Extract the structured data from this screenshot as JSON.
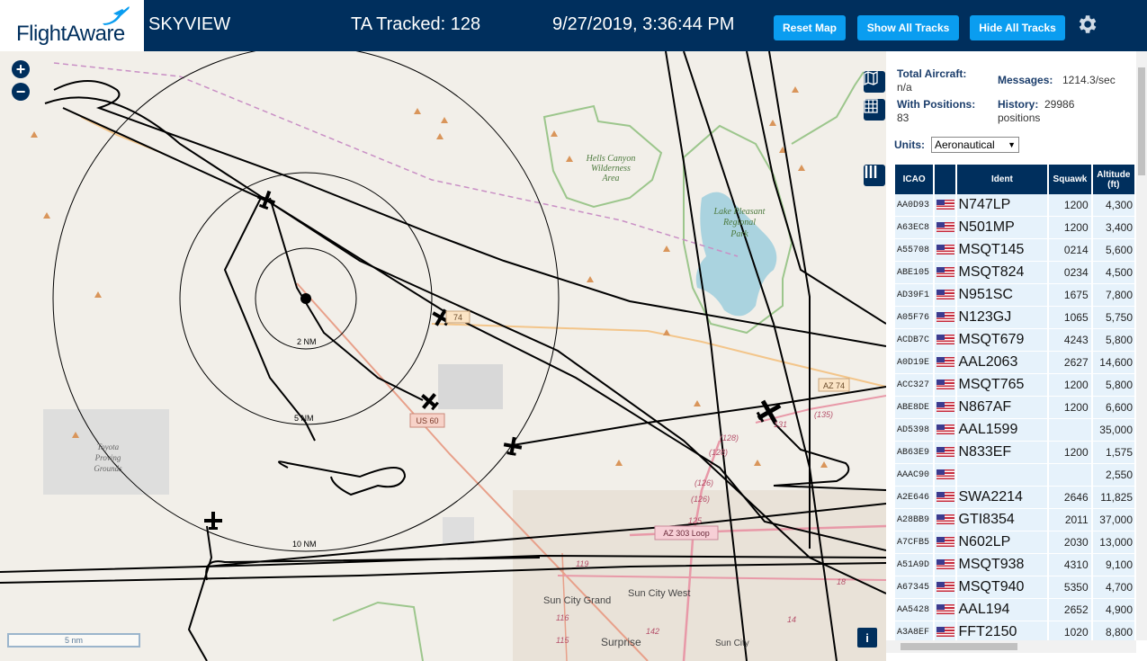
{
  "header": {
    "logo_text": "FlightAware",
    "app_title": "SKYVIEW",
    "ta_tracked": "TA Tracked: 128",
    "clock": "9/27/2019, 3:36:44 PM",
    "reset_map": "Reset Map",
    "show_all_tracks": "Show All Tracks",
    "hide_all_tracks": "Hide All Tracks",
    "settings_icon": "gear-icon",
    "bg_color": "#002f5d",
    "button_color": "#0a9df0"
  },
  "map": {
    "zoom_in": "+",
    "zoom_out": "−",
    "scale_label": "5 nm",
    "info_label": "i",
    "range_rings": [
      "2 NM",
      "5 NM",
      "10 NM"
    ],
    "labels": {
      "hells_canyon": [
        "Hells Canyon",
        "Wilderness",
        "Area"
      ],
      "lake_pleasant": [
        "Lake Pleasant",
        "Regional",
        "Park"
      ],
      "toyota": [
        "Toyota",
        "Proving",
        "Grounds"
      ],
      "sun_city_grand": "Sun City Grand",
      "sun_city_west": "Sun City West",
      "surprise": "Surprise",
      "sun_city": "Sun City",
      "us60": "US 60",
      "az74": "AZ 74",
      "az303": "AZ 303 Loop",
      "r74": "74",
      "r131": "131",
      "r135": "(135)",
      "r128": "(128)",
      "r126": "(126)",
      "r125": "125",
      "r119": "119",
      "r116": "116",
      "r115": "115",
      "r142": "142",
      "r14": "14",
      "r18": "18"
    }
  },
  "stats": {
    "total_aircraft_label": "Total Aircraft:",
    "total_aircraft_value": "n/a",
    "with_positions_label": "With Positions:",
    "with_positions_value": "83",
    "messages_label": "Messages:",
    "messages_value": "1214.3/sec",
    "history_label": "History:",
    "history_value": "29986",
    "history_unit": "positions",
    "units_label": "Units:",
    "units_value": "Aeronautical"
  },
  "table": {
    "headers": {
      "icao": "ICAO",
      "ident": "Ident",
      "squawk": "Squawk",
      "altitude_1": "Altitude",
      "altitude_2": "(ft)"
    },
    "rows": [
      {
        "icao": "AA0D93",
        "ident": "N747LP",
        "squawk": "1200",
        "alt": "4,300"
      },
      {
        "icao": "A63EC8",
        "ident": "N501MP",
        "squawk": "1200",
        "alt": "3,400"
      },
      {
        "icao": "A55708",
        "ident": "MSQT145",
        "squawk": "0214",
        "alt": "5,600"
      },
      {
        "icao": "ABE105",
        "ident": "MSQT824",
        "squawk": "0234",
        "alt": "4,500"
      },
      {
        "icao": "AD39F1",
        "ident": "N951SC",
        "squawk": "1675",
        "alt": "7,800"
      },
      {
        "icao": "A05F76",
        "ident": "N123GJ",
        "squawk": "1065",
        "alt": "5,750"
      },
      {
        "icao": "ACDB7C",
        "ident": "MSQT679",
        "squawk": "4243",
        "alt": "5,800"
      },
      {
        "icao": "A0D19E",
        "ident": "AAL2063",
        "squawk": "2627",
        "alt": "14,600"
      },
      {
        "icao": "ACC327",
        "ident": "MSQT765",
        "squawk": "1200",
        "alt": "5,800"
      },
      {
        "icao": "ABE8DE",
        "ident": "N867AF",
        "squawk": "1200",
        "alt": "6,600"
      },
      {
        "icao": "AD5398",
        "ident": "AAL1599",
        "squawk": "",
        "alt": "35,000"
      },
      {
        "icao": "AB63E9",
        "ident": "N833EF",
        "squawk": "1200",
        "alt": "1,575"
      },
      {
        "icao": "AAAC90",
        "ident": "",
        "squawk": "",
        "alt": "2,550"
      },
      {
        "icao": "A2E646",
        "ident": "SWA2214",
        "squawk": "2646",
        "alt": "11,825"
      },
      {
        "icao": "A28BB9",
        "ident": "GTI8354",
        "squawk": "2011",
        "alt": "37,000"
      },
      {
        "icao": "A7CFB5",
        "ident": "N602LP",
        "squawk": "2030",
        "alt": "13,000"
      },
      {
        "icao": "A51A9D",
        "ident": "MSQT938",
        "squawk": "4310",
        "alt": "9,100"
      },
      {
        "icao": "A67345",
        "ident": "MSQT940",
        "squawk": "5350",
        "alt": "4,700"
      },
      {
        "icao": "AA5428",
        "ident": "AAL194",
        "squawk": "2652",
        "alt": "4,900"
      },
      {
        "icao": "A3A8EF",
        "ident": "FFT2150",
        "squawk": "1020",
        "alt": "8,800"
      }
    ]
  }
}
